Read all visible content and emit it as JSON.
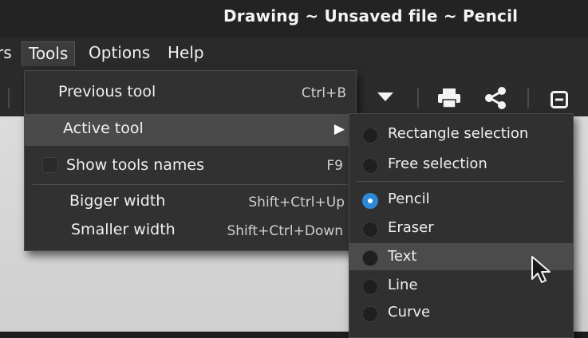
{
  "window": {
    "title": "Drawing ~ Unsaved file ~ Pencil"
  },
  "menubar": {
    "items": [
      {
        "label": "rs"
      },
      {
        "label": "Tools"
      },
      {
        "label": "Options"
      },
      {
        "label": "Help"
      }
    ]
  },
  "toolbar": {
    "icons": [
      "dropdown-arrow-icon",
      "print-icon",
      "share-icon",
      "window-icon"
    ]
  },
  "tools_menu": {
    "items": [
      {
        "label": "Previous tool",
        "accel": "Ctrl+B"
      },
      {
        "label": "Active tool",
        "submenu_arrow": "▶"
      },
      {
        "label": "Show tools names",
        "accel": "F9",
        "checked": false
      },
      {
        "label": "Bigger width",
        "accel": "Shift+Ctrl+Up"
      },
      {
        "label": "Smaller width",
        "accel": "Shift+Ctrl+Down"
      }
    ]
  },
  "active_tool_submenu": {
    "items": [
      {
        "label": "Rectangle selection",
        "selected": false
      },
      {
        "label": "Free selection",
        "selected": false
      },
      {
        "label": "Pencil",
        "selected": true
      },
      {
        "label": "Eraser",
        "selected": false
      },
      {
        "label": "Text",
        "selected": false,
        "hovered": true
      },
      {
        "label": "Line",
        "selected": false
      },
      {
        "label": "Curve",
        "selected": false
      }
    ]
  },
  "colors": {
    "accent": "#2b8ad8",
    "menu_bg": "#313131",
    "highlight": "#4a4a4a"
  }
}
